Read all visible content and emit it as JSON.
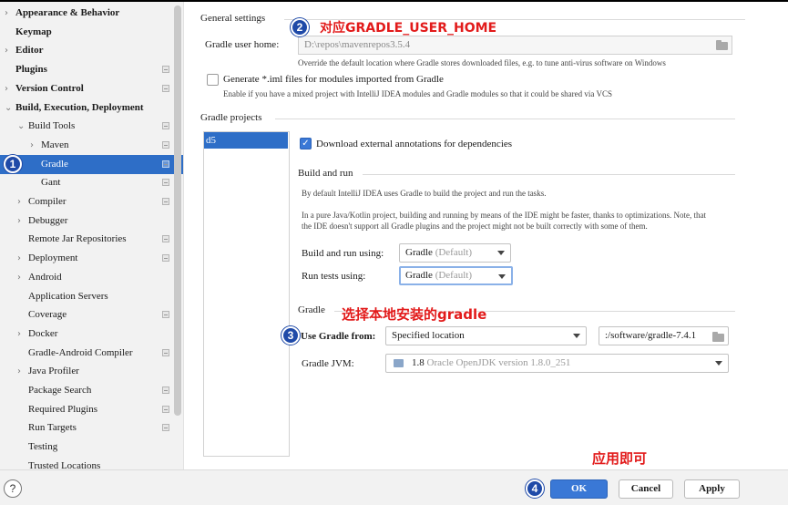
{
  "sidebar": {
    "items": [
      {
        "label": "Appearance & Behavior",
        "arrow": "›",
        "bold": true
      },
      {
        "label": "Keymap",
        "bold": true
      },
      {
        "label": "Editor",
        "arrow": "›",
        "bold": true
      },
      {
        "label": "Plugins",
        "bold": true,
        "icon": true
      },
      {
        "label": "Version Control",
        "arrow": "›",
        "bold": true,
        "icon": true
      },
      {
        "label": "Build, Execution, Deployment",
        "arrow": "⌄",
        "bold": true
      },
      {
        "label": "Build Tools",
        "arrow": "⌄",
        "icon": true
      },
      {
        "label": "Maven",
        "arrow": "›",
        "icon": true
      },
      {
        "label": "Gradle",
        "icon": true,
        "selected": true
      },
      {
        "label": "Gant",
        "icon": true
      },
      {
        "label": "Compiler",
        "arrow": "›",
        "icon": true
      },
      {
        "label": "Debugger",
        "arrow": "›"
      },
      {
        "label": "Remote Jar Repositories",
        "icon": true
      },
      {
        "label": "Deployment",
        "arrow": "›",
        "icon": true
      },
      {
        "label": "Android",
        "arrow": "›"
      },
      {
        "label": "Application Servers"
      },
      {
        "label": "Coverage",
        "icon": true
      },
      {
        "label": "Docker",
        "arrow": "›"
      },
      {
        "label": "Gradle-Android Compiler",
        "icon": true
      },
      {
        "label": "Java Profiler",
        "arrow": "›"
      },
      {
        "label": "Package Search",
        "icon": true
      },
      {
        "label": "Required Plugins",
        "icon": true
      },
      {
        "label": "Run Targets",
        "icon": true
      },
      {
        "label": "Testing"
      },
      {
        "label": "Trusted Locations"
      }
    ]
  },
  "general": {
    "title": "General settings",
    "user_home_label": "Gradle user home:",
    "user_home_value": "D:\\repos\\mavenrepos3.5.4",
    "user_home_hint": "Override the default location where Gradle stores downloaded files, e.g. to tune anti-virus software on Windows",
    "iml_label": "Generate *.iml files for modules imported from Gradle",
    "iml_hint": "Enable if you have a mixed project with IntelliJ IDEA modules and Gradle modules so that it could be shared via VCS"
  },
  "projects": {
    "title": "Gradle projects",
    "list": [
      "d5"
    ],
    "download_annotations": "Download external annotations for dependencies"
  },
  "build_run": {
    "title": "Build and run",
    "desc1": "By default IntelliJ IDEA uses Gradle to build the project and run the tasks.",
    "desc2a": "In a pure Java/Kotlin project, building and running by means of the IDE might be faster, thanks to optimizations. Note, that",
    "desc2b": "the IDE doesn't support all Gradle plugins and the project might not be built correctly with some of them.",
    "build_label": "Build and run using:",
    "build_value": "Gradle",
    "build_suffix": "(Default)",
    "tests_label": "Run tests using:",
    "tests_value": "Gradle",
    "tests_suffix": "(Default)"
  },
  "gradle": {
    "title": "Gradle",
    "use_from_label": "Use Gradle from:",
    "use_from_value": "Specified location",
    "location_value": ":/software/gradle-7.4.1",
    "jvm_label": "Gradle JVM:",
    "jvm_version": "1.8",
    "jvm_detail": "Oracle OpenJDK version 1.8.0_251"
  },
  "buttons": {
    "help": "?",
    "ok": "OK",
    "cancel": "Cancel",
    "apply": "Apply"
  },
  "annotations": {
    "m1": "1",
    "m2": "2",
    "m3": "3",
    "m4": "4",
    "a2": "对应GRADLE_USER_HOME",
    "a3": "选择本地安装的gradle",
    "a4": "应用即可"
  },
  "colors": {
    "accent": "#2e6ec7",
    "primary_button": "#3a78d6",
    "annotation": "#e21b1b",
    "marker": "#1f4aa8"
  }
}
